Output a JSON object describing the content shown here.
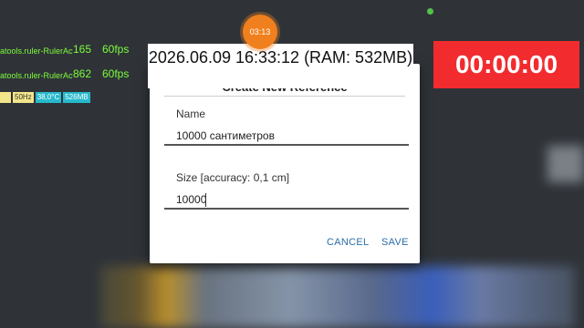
{
  "overlay": {
    "bubble_text": "03:13",
    "timestamp": "2026.06.09 16:33:12 (RAM: 532MB)",
    "timer": "00:00:00"
  },
  "debug": {
    "lines": [
      {
        "package": "atools.ruler-RulerActi",
        "value": "165",
        "fps": "60fps"
      },
      {
        "package": "atools.ruler-RulerActi",
        "value": "862",
        "fps": "60fps"
      }
    ],
    "chips": [
      {
        "text": "",
        "color": "#f3e58a"
      },
      {
        "text": "50Hz",
        "color": "#f3e58a"
      },
      {
        "text": "38,0°C",
        "color": "#27b9cc"
      },
      {
        "text": "526MB",
        "color": "#27b9cc"
      }
    ]
  },
  "dialog": {
    "title": "Create New Reference",
    "name_label": "Name",
    "name_value": "10000 сантиметров",
    "size_label": "Size [accuracy: 0,1 cm]",
    "size_value": "10000",
    "cancel_label": "CANCEL",
    "save_label": "SAVE",
    "accent_color": "#2c6ea8"
  },
  "colors": {
    "timer_bg": "#f22b2e",
    "bubble_bg": "#f0801e",
    "fps_text": "#7cfc3c"
  }
}
